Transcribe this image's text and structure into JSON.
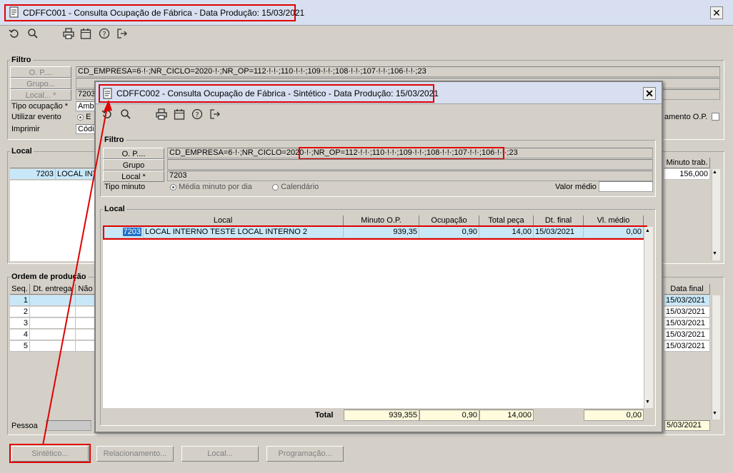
{
  "main_window": {
    "title": "CDFFC001 - Consulta Ocupação de Fábrica - Data Produção: 15/03/2021",
    "filter_title": "Filtro",
    "op_button": "O. P....",
    "grupo_button": "Grupo...",
    "local_button": "Local... *",
    "op_value": "CD_EMPRESA=6·!·;NR_CICLO=2020·!·;NR_OP=112·!·!·;110·!·!·;109·!·!·;108·!·!·;107·!·!·;106·!·!·;23",
    "local_value": "7203",
    "tipo_ocupacao_label": "Tipo ocupação *",
    "tipo_ocupacao_value": "Amb",
    "utilizar_evento_label": "Utilizar evento",
    "utilizar_evento_value": "E",
    "imprimir_label": "Imprimir",
    "imprimir_value": "Códi",
    "agrupamento_label": "amento O.P.",
    "local_section_title": "Local",
    "minuto_trab_header": "Minuto trab.",
    "local_row": {
      "code": "7203",
      "name": "LOCAL INT",
      "minuto": "156,000"
    },
    "ordem_title": "Ordem de produção",
    "ordem_headers": [
      "Seq.",
      "Dt. entrega",
      "Não"
    ],
    "data_final_header": "Data final",
    "ordem_rows": [
      {
        "seq": "1",
        "data_final": "15/03/2021"
      },
      {
        "seq": "2",
        "data_final": "15/03/2021"
      },
      {
        "seq": "3",
        "data_final": "15/03/2021"
      },
      {
        "seq": "4",
        "data_final": "15/03/2021"
      },
      {
        "seq": "5",
        "data_final": "15/03/2021"
      }
    ],
    "pessoa_label": "Pessoa",
    "bottom_date": "5/03/2021",
    "bottom_buttons": [
      "Sintético...",
      "Relacionamento...",
      "Local...",
      "Programação..."
    ]
  },
  "dialog": {
    "title": "CDFFC002 - Consulta Ocupação de Fábrica - Sintético - Data Produção: 15/03/2021",
    "filter_title": "Filtro",
    "op_button": "O. P....",
    "grupo_button": "Grupo",
    "local_button": "Local *",
    "op_value_prefix": "CD_EMPRESA=6·!·;NR_CICLO=2020·!·;",
    "op_value_highlight": "NR_OP=112·!·!·;110·!·!·;109·!·!·;108·!·!·;107·!·!·;106·!·!·;23",
    "local_value": "7203",
    "tipo_minuto_label": "Tipo minuto",
    "radio_media": "Média minuto por dia",
    "radio_calendario": "Calendário",
    "valor_medio_label": "Valor médio",
    "local_section_title": "Local",
    "headers": [
      "Local",
      "Minuto O.P.",
      "Ocupação",
      "Total peça",
      "Dt. final",
      "Vl. médio"
    ],
    "row": {
      "code": "7203",
      "name": "LOCAL INTERNO TESTE LOCAL INTERNO 2",
      "minuto_op": "939,35",
      "ocupacao": "0,90",
      "total_peca": "14,00",
      "dt_final": "15/03/2021",
      "vl_medio": "0,00"
    },
    "total_label": "Total",
    "totals": {
      "minuto_op": "939,355",
      "ocupacao": "0,90",
      "total_peca": "14,000",
      "vl_medio": "0,00"
    }
  },
  "colors": {
    "highlight": "#e00000",
    "title_bar": "#d7dff0",
    "selection": "#c8e8f8",
    "total_field": "#fffbdc"
  }
}
